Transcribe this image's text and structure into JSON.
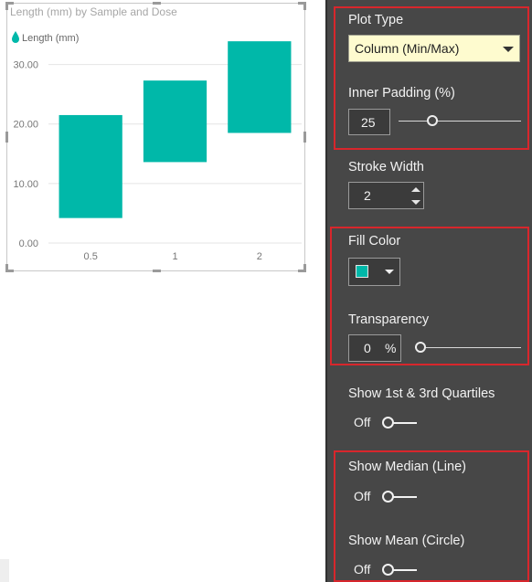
{
  "chart_data": {
    "type": "bar",
    "title": "Length (mm) by Sample and Dose",
    "legend": [
      "Length (mm)"
    ],
    "legend_position": "top-left",
    "categories": [
      "0.5",
      "1",
      "2"
    ],
    "series": [
      {
        "name": "Length (mm)",
        "min": [
          4.2,
          13.6,
          18.5
        ],
        "max": [
          21.5,
          27.3,
          33.9
        ]
      }
    ],
    "y_ticks": [
      "0.00",
      "10.00",
      "20.00",
      "30.00"
    ],
    "ylim": [
      0,
      35
    ],
    "grid": true,
    "fill_color": "#00b8a9"
  },
  "format_pane": {
    "plot_type": {
      "label": "Plot Type",
      "value": "Column (Min/Max)"
    },
    "inner_padding": {
      "label": "Inner Padding (%)",
      "value": "25",
      "fraction": 0.25
    },
    "stroke_width": {
      "label": "Stroke Width",
      "value": "2"
    },
    "fill_color": {
      "label": "Fill Color",
      "color": "#00b8a9"
    },
    "transparency": {
      "label": "Transparency",
      "value": "0",
      "unit": "%",
      "fraction": 0
    },
    "quartiles": {
      "label": "Show 1st & 3rd Quartiles",
      "state": "Off"
    },
    "median": {
      "label": "Show Median (Line)",
      "state": "Off"
    },
    "mean": {
      "label": "Show Mean (Circle)",
      "state": "Off"
    }
  },
  "colors": {
    "pane_bg": "#474747",
    "highlight": "#d8262c",
    "dropdown_bg": "#fefbcf"
  }
}
